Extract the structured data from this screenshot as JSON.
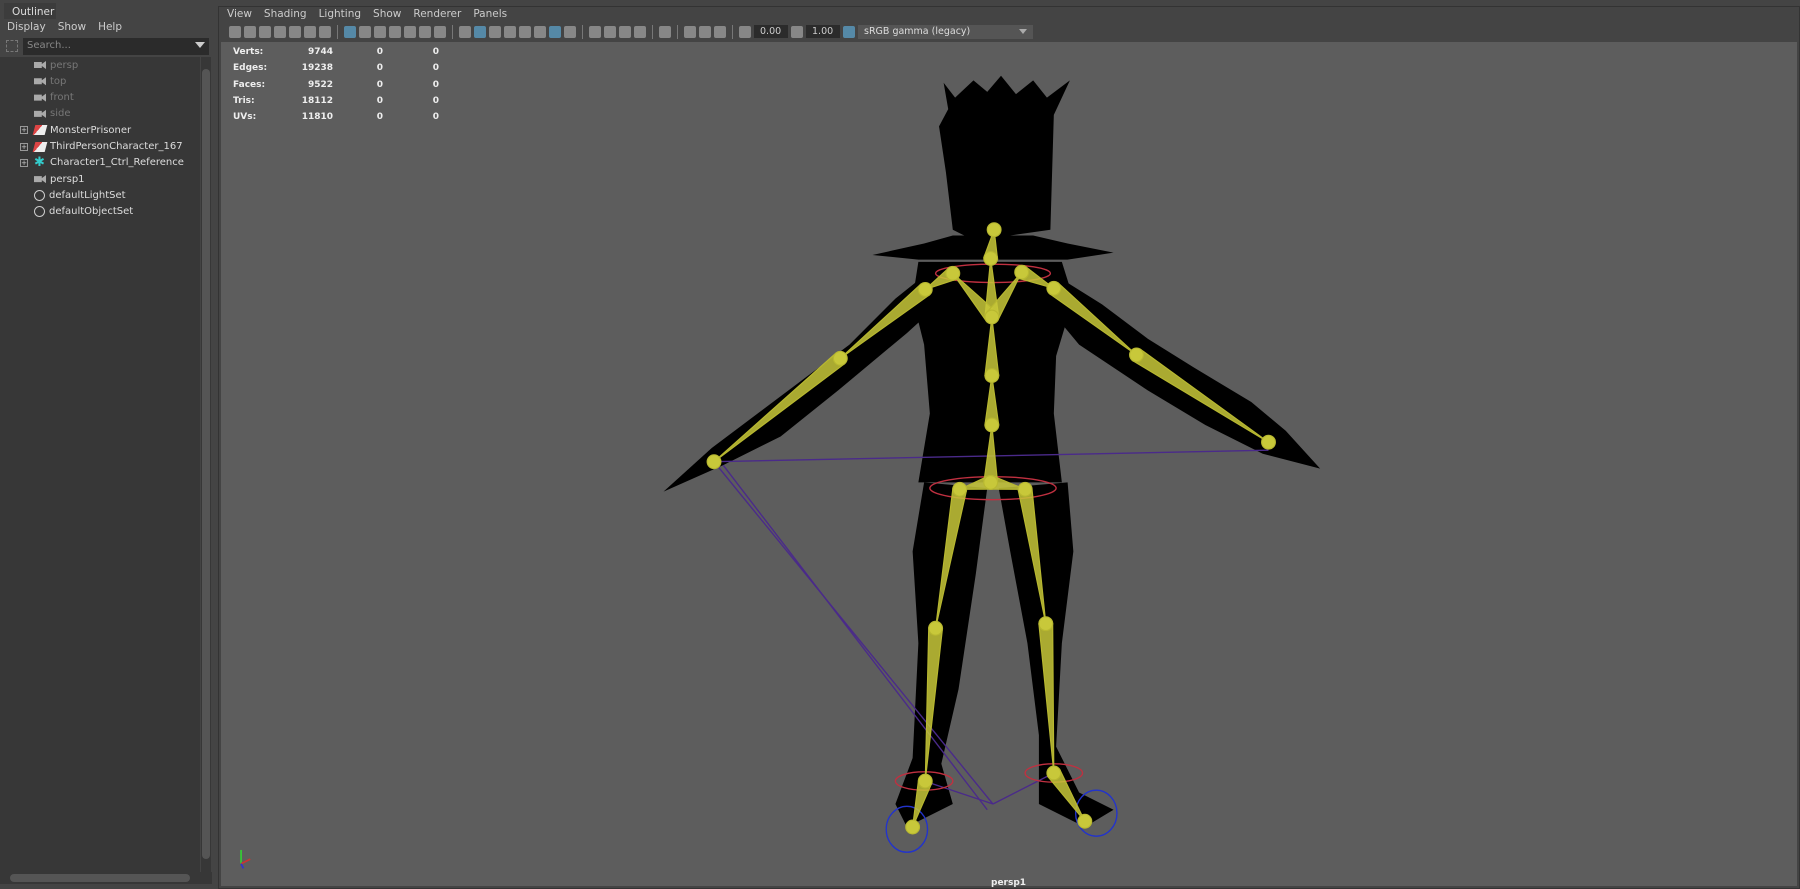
{
  "outliner": {
    "tab": "Outliner",
    "menu": [
      "Display",
      "Show",
      "Help"
    ],
    "search_placeholder": "Search...",
    "items": [
      {
        "label": "persp",
        "icon": "camera-icon",
        "dim": true
      },
      {
        "label": "top",
        "icon": "camera-icon",
        "dim": true
      },
      {
        "label": "front",
        "icon": "camera-icon",
        "dim": true
      },
      {
        "label": "side",
        "icon": "camera-icon",
        "dim": true
      },
      {
        "label": "MonsterPrisoner",
        "icon": "mesh-transform-icon",
        "expand": true
      },
      {
        "label": "ThirdPersonCharacter_167",
        "icon": "mesh-transform-icon",
        "expand": true
      },
      {
        "label": "Character1_Ctrl_Reference",
        "icon": "hik-reference-icon",
        "expand": true
      },
      {
        "label": "persp1",
        "icon": "camera-icon"
      },
      {
        "label": "defaultLightSet",
        "icon": "set-icon"
      },
      {
        "label": "defaultObjectSet",
        "icon": "set-icon"
      }
    ]
  },
  "viewport": {
    "menu": [
      "View",
      "Shading",
      "Lighting",
      "Show",
      "Renderer",
      "Panels"
    ],
    "exposure": "0.00",
    "gamma": "1.00",
    "color_space": "sRGB gamma (legacy)",
    "camera": "persp1",
    "hud": [
      [
        "Verts:",
        "9744",
        "0",
        "0"
      ],
      [
        "Edges:",
        "19238",
        "0",
        "0"
      ],
      [
        "Faces:",
        "9522",
        "0",
        "0"
      ],
      [
        "Tris:",
        "18112",
        "0",
        "0"
      ],
      [
        "UVs:",
        "11810",
        "0",
        "0"
      ]
    ]
  }
}
